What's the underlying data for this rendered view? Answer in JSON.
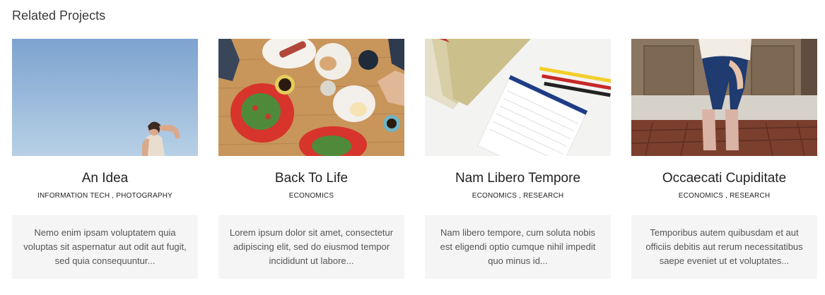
{
  "section": {
    "title": "Related Projects"
  },
  "projects": [
    {
      "title": "An Idea",
      "categories": [
        "INFORMATION TECH",
        "PHOTOGRAPHY"
      ],
      "excerpt": "Nemo enim ipsam voluptatem quia voluptas sit aspernatur aut odit aut fugit, sed quia consequuntur...",
      "image": "woman-shading-eyes-sky-photo"
    },
    {
      "title": "Back To Life",
      "categories": [
        "ECONOMICS"
      ],
      "excerpt": "Lorem ipsum dolor sit amet, consectetur adipiscing elit, sed do eiusmod tempor incididunt ut labore...",
      "image": "breakfast-table-photo"
    },
    {
      "title": "Nam Libero Tempore",
      "categories": [
        "ECONOMICS",
        "RESEARCH"
      ],
      "excerpt": "Nam libero tempore, cum soluta nobis est eligendi optio cumque nihil impedit quo minus id...",
      "image": "notebook-and-pencils-photo"
    },
    {
      "title": "Occaecati Cupiditate",
      "categories": [
        "ECONOMICS",
        "RESEARCH"
      ],
      "excerpt": "Temporibus autem quibusdam et aut officiis debitis aut rerum necessitatibus saepe eveniet ut et voluptates...",
      "image": "woman-sitting-on-steps-photo"
    }
  ]
}
